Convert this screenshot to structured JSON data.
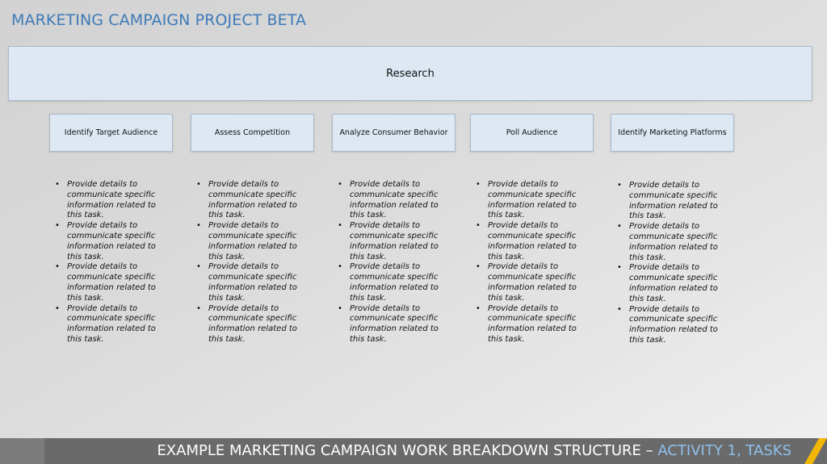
{
  "page": {
    "title": "MARKETING CAMPAIGN PROJECT BETA"
  },
  "wbs": {
    "root": "Research",
    "tasks": [
      {
        "label": "Identify Target Audience",
        "details": [
          "Provide details to communicate specific information related to this task.",
          "Provide details to communicate specific information related to this task.",
          "Provide details to communicate specific information related to this task.",
          "Provide details to communicate specific information related to this task."
        ]
      },
      {
        "label": "Assess Competition",
        "details": [
          "Provide details to communicate specific information related to this task.",
          "Provide details to communicate specific information related to this task.",
          "Provide details to communicate specific information related to this task.",
          "Provide details to communicate specific information related to this task."
        ]
      },
      {
        "label": "Analyze Consumer Behavior",
        "details": [
          "Provide details to communicate specific information related to this task.",
          "Provide details to communicate specific information related to this task.",
          "Provide details to communicate specific information related to this task.",
          "Provide details to communicate specific information related to this task."
        ]
      },
      {
        "label": "Poll Audience",
        "details": [
          "Provide details to communicate specific information related to this task.",
          "Provide details to communicate specific information related to this task.",
          "Provide details to communicate specific information related to this task.",
          "Provide details to communicate specific information related to this task."
        ]
      },
      {
        "label": "Identify Marketing Platforms",
        "details": [
          "Provide details to communicate specific information related to this task.",
          "Provide details to communicate specific information related to this task.",
          "Provide details to communicate specific information related to this task.",
          "Provide details to communicate specific information related to this task."
        ]
      }
    ]
  },
  "footer": {
    "text_main": "EXAMPLE MARKETING CAMPAIGN WORK BREAKDOWN STRUCTURE – ",
    "text_accent": "ACTIVITY 1, TASKS"
  },
  "colors": {
    "title": "#3d7ab8",
    "box_fill": "#dde8f3",
    "footer_bg": "#6a6a6a",
    "footer_accent": "#8fc0ea",
    "stripe": "#f2b705"
  }
}
